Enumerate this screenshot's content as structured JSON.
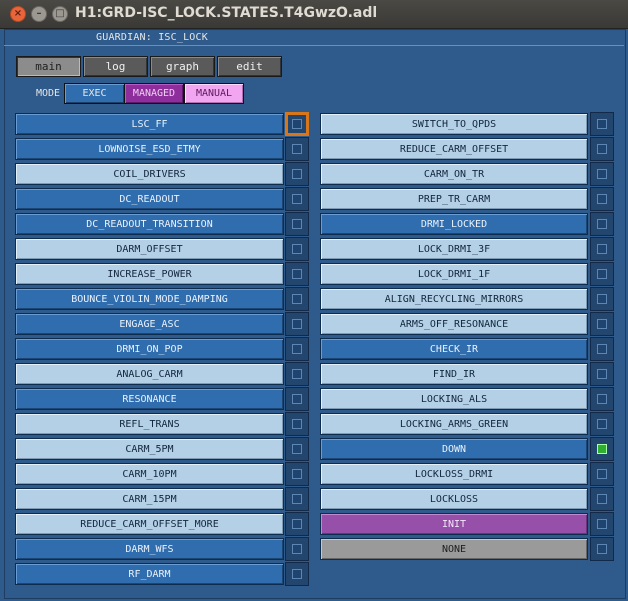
{
  "window": {
    "title": "H1:GRD-ISC_LOCK.STATES.T4GwzO.adl",
    "close_glyph": "×",
    "minimize_glyph": "–",
    "maximize_glyph": "□"
  },
  "header": {
    "guardian_label": "GUARDIAN: ISC_LOCK"
  },
  "nav": {
    "main": "main",
    "log": "log",
    "graph": "graph",
    "edit": "edit"
  },
  "mode": {
    "label": "MODE",
    "exec": "EXEC",
    "managed": "MANAGED",
    "manual": "MANUAL"
  },
  "colors": {
    "state_dark": "#2f6dae",
    "state_light": "#b4d0e6",
    "init": "#9650aa",
    "none": "#9a9a9a",
    "target_outline": "#d9761a",
    "active_indicator": "#2fae2f",
    "background": "#2e5a8c"
  },
  "left_states": [
    {
      "label": "LSC_FF",
      "style": "dark",
      "indicator": "target"
    },
    {
      "label": "LOWNOISE_ESD_ETMY",
      "style": "dark",
      "indicator": "normal"
    },
    {
      "label": "COIL_DRIVERS",
      "style": "light",
      "indicator": "normal"
    },
    {
      "label": "DC_READOUT",
      "style": "dark",
      "indicator": "normal"
    },
    {
      "label": "DC_READOUT_TRANSITION",
      "style": "dark",
      "indicator": "normal"
    },
    {
      "label": "DARM_OFFSET",
      "style": "light",
      "indicator": "normal"
    },
    {
      "label": "INCREASE_POWER",
      "style": "light",
      "indicator": "normal"
    },
    {
      "label": "BOUNCE_VIOLIN_MODE_DAMPING",
      "style": "dark",
      "indicator": "normal"
    },
    {
      "label": "ENGAGE_ASC",
      "style": "dark",
      "indicator": "normal"
    },
    {
      "label": "DRMI_ON_POP",
      "style": "dark",
      "indicator": "normal"
    },
    {
      "label": "ANALOG_CARM",
      "style": "light",
      "indicator": "normal"
    },
    {
      "label": "RESONANCE",
      "style": "dark",
      "indicator": "normal"
    },
    {
      "label": "REFL_TRANS",
      "style": "light",
      "indicator": "normal"
    },
    {
      "label": "CARM_5PM",
      "style": "light",
      "indicator": "normal"
    },
    {
      "label": "CARM_10PM",
      "style": "light",
      "indicator": "normal"
    },
    {
      "label": "CARM_15PM",
      "style": "light",
      "indicator": "normal"
    },
    {
      "label": "REDUCE_CARM_OFFSET_MORE",
      "style": "light",
      "indicator": "normal"
    },
    {
      "label": "DARM_WFS",
      "style": "dark",
      "indicator": "normal"
    },
    {
      "label": "RF_DARM",
      "style": "dark",
      "indicator": "normal"
    }
  ],
  "right_states": [
    {
      "label": "SWITCH_TO_QPDS",
      "style": "light",
      "indicator": "normal"
    },
    {
      "label": "REDUCE_CARM_OFFSET",
      "style": "light",
      "indicator": "normal"
    },
    {
      "label": "CARM_ON_TR",
      "style": "light",
      "indicator": "normal"
    },
    {
      "label": "PREP_TR_CARM",
      "style": "light",
      "indicator": "normal"
    },
    {
      "label": "DRMI_LOCKED",
      "style": "dark",
      "indicator": "normal"
    },
    {
      "label": "LOCK_DRMI_3F",
      "style": "light",
      "indicator": "normal"
    },
    {
      "label": "LOCK_DRMI_1F",
      "style": "light",
      "indicator": "normal"
    },
    {
      "label": "ALIGN_RECYCLING_MIRRORS",
      "style": "light",
      "indicator": "normal"
    },
    {
      "label": "ARMS_OFF_RESONANCE",
      "style": "light",
      "indicator": "normal"
    },
    {
      "label": "CHECK_IR",
      "style": "dark",
      "indicator": "normal"
    },
    {
      "label": "FIND_IR",
      "style": "light",
      "indicator": "normal"
    },
    {
      "label": "LOCKING_ALS",
      "style": "light",
      "indicator": "normal"
    },
    {
      "label": "LOCKING_ARMS_GREEN",
      "style": "light",
      "indicator": "normal"
    },
    {
      "label": "DOWN",
      "style": "dark",
      "indicator": "active"
    },
    {
      "label": "LOCKLOSS_DRMI",
      "style": "light",
      "indicator": "normal"
    },
    {
      "label": "LOCKLOSS",
      "style": "light",
      "indicator": "normal"
    },
    {
      "label": "INIT",
      "style": "init",
      "indicator": "normal"
    },
    {
      "label": "NONE",
      "style": "none",
      "indicator": "normal"
    }
  ]
}
